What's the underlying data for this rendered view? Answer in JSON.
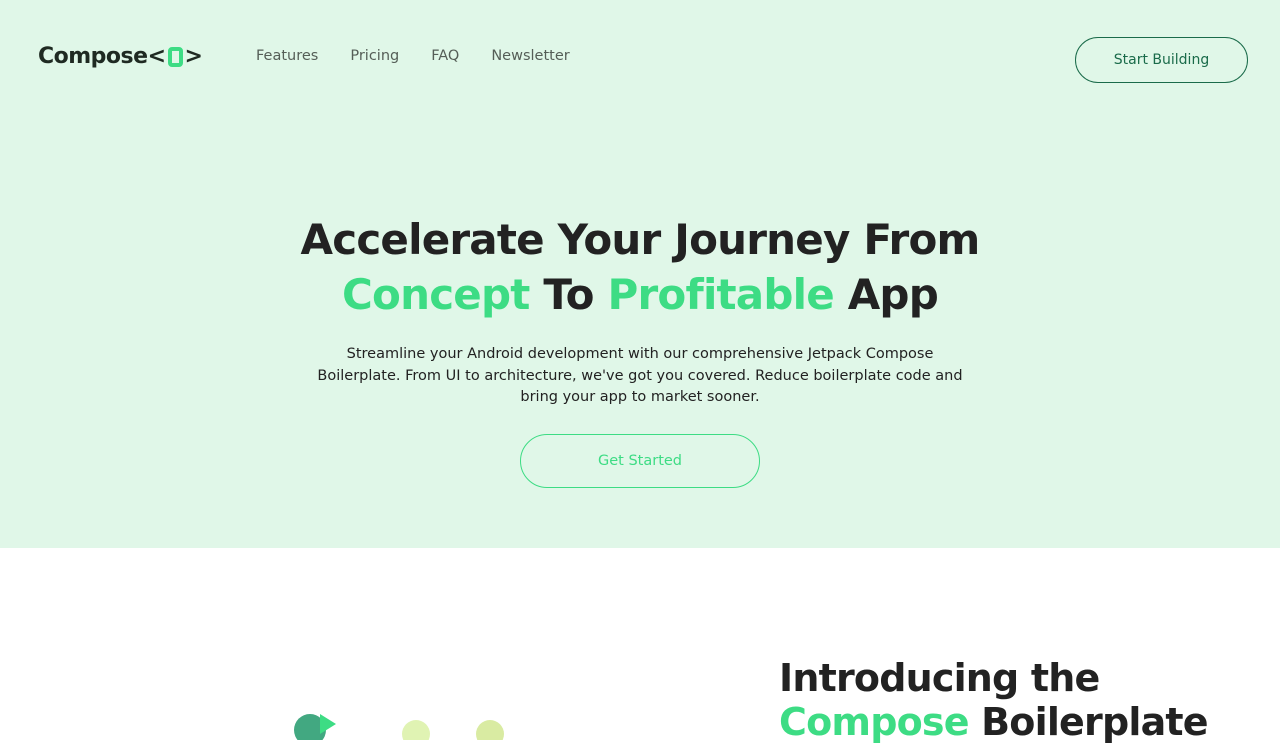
{
  "header": {
    "logo": {
      "text": "Compose",
      "open_bracket": "<",
      "close_bracket": ">"
    },
    "nav": [
      "Features",
      "Pricing",
      "FAQ",
      "Newsletter"
    ],
    "cta_label": "Start Building"
  },
  "hero": {
    "headline": {
      "line1": "Accelerate Your Journey From",
      "word1": "Concept",
      "mid": " To ",
      "word2": "Profitable",
      "end": " App"
    },
    "subtext": "Streamline your Android development with our comprehensive Jetpack Compose Boilerplate. From UI to architecture, we've got you covered. Reduce boilerplate code and bring your app to market sooner.",
    "button_label": "Get Started"
  },
  "intro": {
    "line1": "Introducing the",
    "accent": "Compose",
    "rest": " Boilerplate"
  },
  "colors": {
    "hero_bg": "#e0f7e8",
    "accent": "#3ddc84",
    "dark_green": "#1a6b4a",
    "text": "#222222"
  },
  "icons": [
    "logo-mark-icon"
  ]
}
